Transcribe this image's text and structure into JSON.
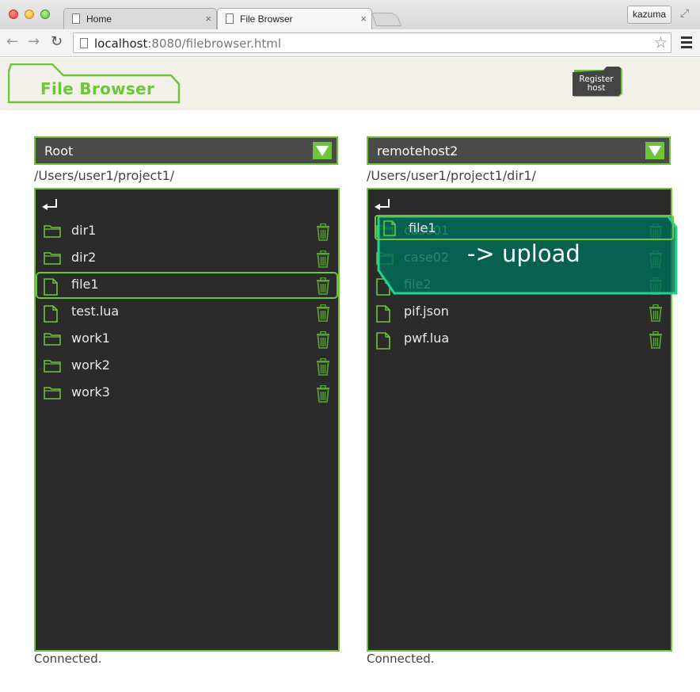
{
  "browser": {
    "tabs": [
      {
        "title": "Home"
      },
      {
        "title": "File Browser"
      }
    ],
    "close_glyph": "×",
    "profile_name": "kazuma",
    "url_host": "localhost",
    "url_rest": ":8080/filebrowser.html"
  },
  "app": {
    "title": "File Browser",
    "register_line1": "Register",
    "register_line2": "host",
    "accent_color": "#6ec53c"
  },
  "left": {
    "host": "Root",
    "path": "/Users/user1/project1/",
    "status": "Connected.",
    "entries": [
      {
        "name": "dir1",
        "type": "folder"
      },
      {
        "name": "dir2",
        "type": "folder"
      },
      {
        "name": "file1",
        "type": "file",
        "selected": true
      },
      {
        "name": "test.lua",
        "type": "file"
      },
      {
        "name": "work1",
        "type": "folder"
      },
      {
        "name": "work2",
        "type": "folder"
      },
      {
        "name": "work3",
        "type": "folder"
      }
    ]
  },
  "right": {
    "host": "remotehost2",
    "path": "/Users/user1/project1/dir1/",
    "status": "Connected.",
    "entries": [
      {
        "name": "case01",
        "type": "folder"
      },
      {
        "name": "case02",
        "type": "folder"
      },
      {
        "name": "file2",
        "type": "file"
      },
      {
        "name": "pif.json",
        "type": "file"
      },
      {
        "name": "pwf.lua",
        "type": "file"
      }
    ]
  },
  "drag": {
    "file_name": "file1",
    "hint": "-> upload"
  }
}
